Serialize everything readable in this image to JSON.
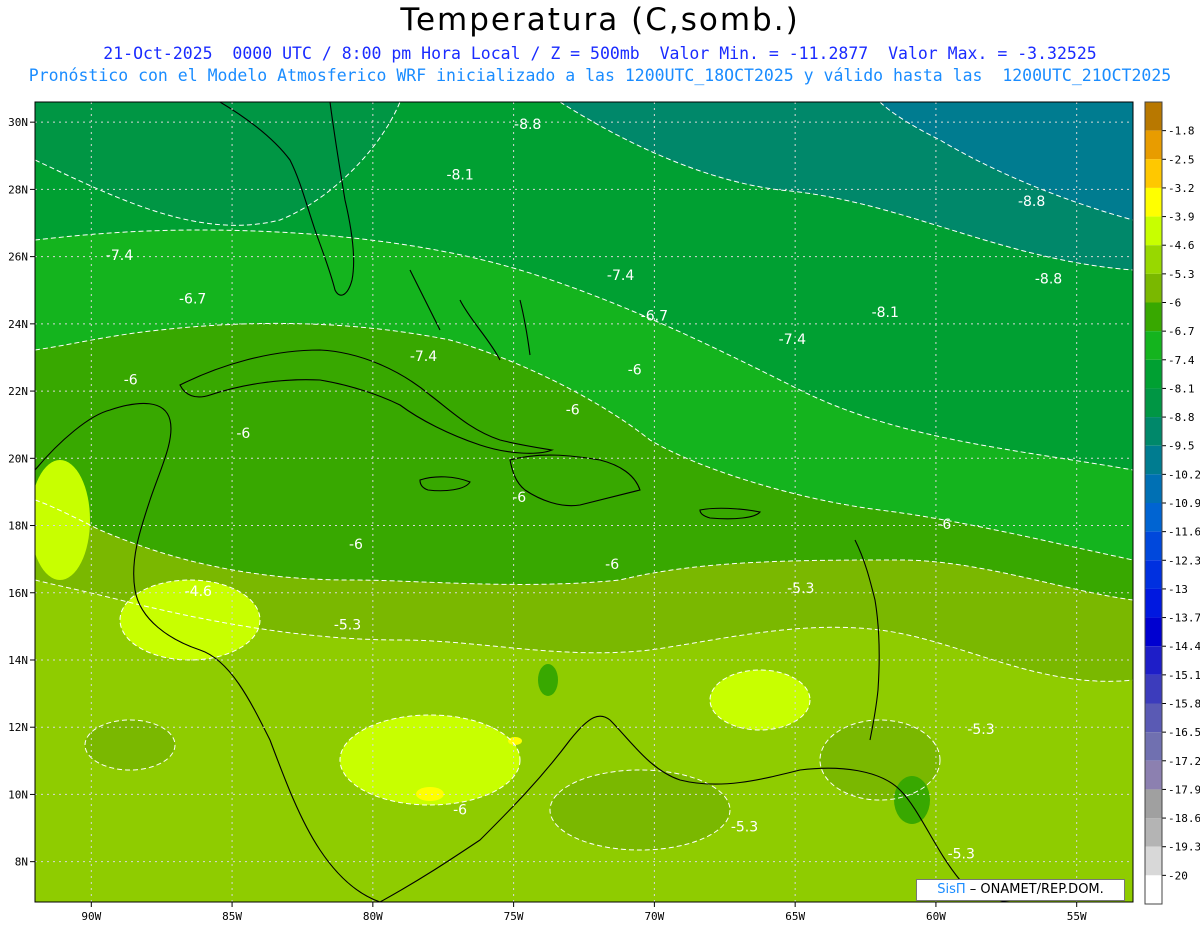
{
  "title": "Temperatura (C,somb.)",
  "subtitle": "21-Oct-2025  0000 UTC / 8:00 pm Hora Local / Z = 500mb  Valor Min. = -11.2877  Valor Max. = -3.32525",
  "subtitle2": "Pronóstico con el Modelo Atmosferico WRF inicializado a las 1200UTC_18OCT2025 y válido hasta las  1200UTC_21OCT2025",
  "credit": {
    "brand": "SisΠ",
    "text": " – ONAMET/REP.DOM."
  },
  "colors": {
    "frame": "#000000",
    "grid": "#d8d8d8",
    "contour": "#ffffff",
    "coast": "#000000"
  },
  "map": {
    "lon_range": [
      -92,
      -53
    ],
    "lat_range": [
      6.8,
      30.6
    ],
    "lon_ticks": [
      {
        "v": -90,
        "label": "90W"
      },
      {
        "v": -85,
        "label": "85W"
      },
      {
        "v": -80,
        "label": "80W"
      },
      {
        "v": -75,
        "label": "75W"
      },
      {
        "v": -70,
        "label": "70W"
      },
      {
        "v": -65,
        "label": "65W"
      },
      {
        "v": -60,
        "label": "60W"
      },
      {
        "v": -55,
        "label": "55W"
      }
    ],
    "lat_ticks": [
      {
        "v": 30,
        "label": "30N"
      },
      {
        "v": 28,
        "label": "28N"
      },
      {
        "v": 26,
        "label": "26N"
      },
      {
        "v": 24,
        "label": "24N"
      },
      {
        "v": 22,
        "label": "22N"
      },
      {
        "v": 20,
        "label": "20N"
      },
      {
        "v": 18,
        "label": "18N"
      },
      {
        "v": 16,
        "label": "16N"
      },
      {
        "v": 14,
        "label": "14N"
      },
      {
        "v": 12,
        "label": "12N"
      },
      {
        "v": 10,
        "label": "10N"
      },
      {
        "v": 8,
        "label": "8N"
      }
    ]
  },
  "contour_labels": [
    {
      "label": "-8.8",
      "lon": -74.5,
      "lat": 29.8
    },
    {
      "label": "-8.1",
      "lon": -76.9,
      "lat": 28.3
    },
    {
      "label": "-8.8",
      "lon": -56.6,
      "lat": 27.5
    },
    {
      "label": "-7.4",
      "lon": -89.0,
      "lat": 25.9
    },
    {
      "label": "-8.8",
      "lon": -56.0,
      "lat": 25.2
    },
    {
      "label": "-7.4",
      "lon": -71.2,
      "lat": 25.3
    },
    {
      "label": "-6.7",
      "lon": -86.4,
      "lat": 24.6
    },
    {
      "label": "-6.7",
      "lon": -70.0,
      "lat": 24.1
    },
    {
      "label": "-8.1",
      "lon": -61.8,
      "lat": 24.2
    },
    {
      "label": "-7.4",
      "lon": -78.2,
      "lat": 22.9
    },
    {
      "label": "-7.4",
      "lon": -65.1,
      "lat": 23.4
    },
    {
      "label": "-6",
      "lon": -70.7,
      "lat": 22.5
    },
    {
      "label": "-6",
      "lon": -88.6,
      "lat": 22.2
    },
    {
      "label": "-6",
      "lon": -72.9,
      "lat": 21.3
    },
    {
      "label": "-6",
      "lon": -84.6,
      "lat": 20.6
    },
    {
      "label": "-6",
      "lon": -74.8,
      "lat": 18.7
    },
    {
      "label": "-6",
      "lon": -59.7,
      "lat": 17.9
    },
    {
      "label": "-6",
      "lon": -80.6,
      "lat": 17.3
    },
    {
      "label": "-6",
      "lon": -71.5,
      "lat": 16.7
    },
    {
      "label": "-4.6",
      "lon": -86.2,
      "lat": 15.9
    },
    {
      "label": "-5.3",
      "lon": -64.8,
      "lat": 16.0
    },
    {
      "label": "-5.3",
      "lon": -80.9,
      "lat": 14.9
    },
    {
      "label": "-5.3",
      "lon": -58.4,
      "lat": 11.8
    },
    {
      "label": "-6",
      "lon": -76.9,
      "lat": 9.4
    },
    {
      "label": "-5.3",
      "lon": -66.8,
      "lat": 8.9
    },
    {
      "label": "-5.3",
      "lon": -59.1,
      "lat": 8.1
    }
  ],
  "colorbar": {
    "levels": [
      {
        "label": "-1.8",
        "color": "#b87800"
      },
      {
        "label": "-2.5",
        "color": "#e89c00"
      },
      {
        "label": "-3.2",
        "color": "#ffc800"
      },
      {
        "label": "-3.9",
        "color": "#ffff00"
      },
      {
        "label": "-4.6",
        "color": "#c8ff00"
      },
      {
        "label": "-5.3",
        "color": "#98d800"
      },
      {
        "label": "-6",
        "color": "#7ab800"
      },
      {
        "label": "-6.7",
        "color": "#38a800"
      },
      {
        "label": "-7.4",
        "color": "#14b41e"
      },
      {
        "label": "-8.1",
        "color": "#00a032"
      },
      {
        "label": "-8.8",
        "color": "#009644"
      },
      {
        "label": "-9.5",
        "color": "#00886a"
      },
      {
        "label": "-10.2",
        "color": "#007c90"
      },
      {
        "label": "-10.9",
        "color": "#0070b4"
      },
      {
        "label": "-11.6",
        "color": "#0064d2"
      },
      {
        "label": "-12.3",
        "color": "#0048dc"
      },
      {
        "label": "-13",
        "color": "#0030e0"
      },
      {
        "label": "-13.7",
        "color": "#0018e0"
      },
      {
        "label": "-14.4",
        "color": "#0000d0"
      },
      {
        "label": "-15.1",
        "color": "#1e1ec8"
      },
      {
        "label": "-15.8",
        "color": "#3c3cbc"
      },
      {
        "label": "-16.5",
        "color": "#5a5ab4"
      },
      {
        "label": "-17.2",
        "color": "#7070b0"
      },
      {
        "label": "-17.9",
        "color": "#8c80b0"
      },
      {
        "label": "-18.6",
        "color": "#a0a0a0"
      },
      {
        "label": "-19.3",
        "color": "#b4b4b4"
      },
      {
        "label": "-20",
        "color": "#d8d8d8"
      }
    ],
    "last_color": "#ffffff"
  }
}
